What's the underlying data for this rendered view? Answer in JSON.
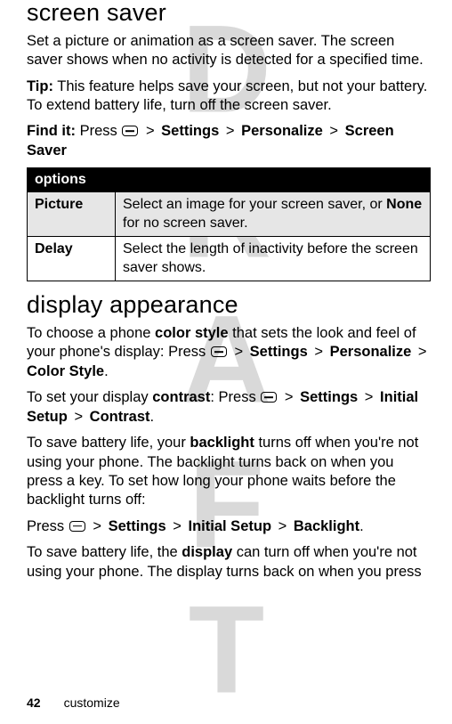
{
  "watermark": "DRAFT",
  "section1": {
    "title": "screen saver",
    "intro": "Set a picture or animation as a screen saver. The screen saver shows when no activity is detected for a specified time.",
    "tip_label": "Tip:",
    "tip_text": " This feature helps save your screen, but not your battery. To extend battery life, turn off the screen saver.",
    "findit_label": "Find it:",
    "findit_press": " Press ",
    "findit_settings": "Settings",
    "findit_personalize": "Personalize",
    "findit_screensaver": "Screen Saver",
    "table": {
      "header": "options",
      "rows": [
        {
          "name": "Picture",
          "desc_pre": "Select an image for your screen saver, or ",
          "desc_cond": "None",
          "desc_post": " for no screen saver."
        },
        {
          "name": "Delay",
          "desc_pre": "Select the length of inactivity before the screen saver shows.",
          "desc_cond": "",
          "desc_post": ""
        }
      ]
    }
  },
  "section2": {
    "title": "display appearance",
    "p1_a": "To choose a phone ",
    "p1_bold": "color style",
    "p1_b": " that sets the look and feel of your phone's display: Press ",
    "p1_settings": "Settings",
    "p1_personalize": "Personalize",
    "p1_colorstyle": "Color Style",
    "p2_a": "To set your display ",
    "p2_bold": "contrast",
    "p2_b": ": Press ",
    "p2_settings": "Settings",
    "p2_initial": "Initial Setup",
    "p2_contrast": "Contrast",
    "p3_a": "To save battery life, your ",
    "p3_bold": "backlight",
    "p3_b": " turns off when you're not using your phone. The backlight turns back on when you press a key. To set how long your phone waits before the backlight turns off:",
    "p4_press": "Press ",
    "p4_settings": "Settings",
    "p4_initial": "Initial Setup",
    "p4_backlight": "Backlight",
    "p5_a": "To save battery life, the ",
    "p5_bold": "display",
    "p5_b": " can turn off when you're not using your phone. The display turns back on when you press"
  },
  "footer": {
    "page": "42",
    "section": "customize"
  },
  "sep": ">",
  "period": "."
}
